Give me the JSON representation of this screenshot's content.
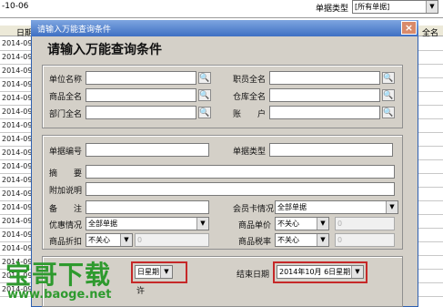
{
  "background": {
    "top_left_text": "-10-06",
    "top_right_label": "单据类型",
    "top_right_value": "[所有单据]",
    "col_header": "日期",
    "right_col_header": "全名",
    "rows": [
      "2014-09-",
      "2014-09-",
      "2014-09-",
      "2014-09-",
      "2014-09-",
      "2014-09-",
      "2014-09-",
      "2014-09-",
      "2014-09-",
      "2014-09-",
      "2014-09-",
      "2014-09-",
      "2014-09-",
      "2014-09-",
      "2014-09-",
      "2014-09-",
      "2014-09-",
      "2014-09-",
      "2014-09-"
    ]
  },
  "dialog": {
    "title": "请输入万能查询条件",
    "close": "×",
    "heading": "请输入万能查询条件",
    "section1": {
      "unit_label": "单位名称",
      "staff_label": "职员全名",
      "product_label": "商品全名",
      "warehouse_label": "仓库全名",
      "dept_label": "部门全名",
      "account_label": "账　　户"
    },
    "section2": {
      "doc_no_label": "单据编号",
      "doc_type_label": "单据类型",
      "summary_label": "摘　　要",
      "extra_label": "附加说明",
      "remark_label": "备　　注",
      "member_label": "会员卡情况",
      "member_value": "全部单据",
      "discount_status_label": "优惠情况",
      "discount_status_value": "全部单据",
      "unit_price_label": "商品单价",
      "unit_price_value": "不关心",
      "unit_price_num": "0",
      "discount_label": "商品折扣",
      "discount_value": "不关心",
      "discount_num": "0",
      "tax_label": "商品税率",
      "tax_value": "不关心",
      "tax_num": "0"
    },
    "section3": {
      "start_value": "日星期",
      "end_label": "结束日期",
      "end_value": "2014年10月 6日星期",
      "partial_text": "许"
    }
  },
  "watermark": {
    "title": "宝哥下载",
    "url": "www.baoge.net"
  }
}
